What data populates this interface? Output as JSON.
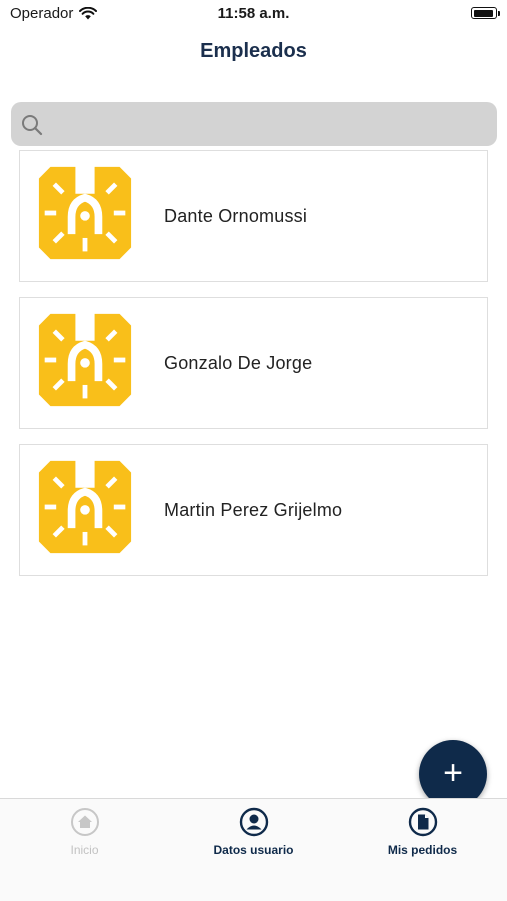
{
  "status_bar": {
    "carrier": "Operador",
    "time": "11:58 a.m."
  },
  "nav": {
    "title": "Empleados"
  },
  "search": {
    "placeholder": ""
  },
  "employees": [
    {
      "name": "Dante  Ornomussi"
    },
    {
      "name": "Gonzalo  De Jorge"
    },
    {
      "name": "Martin  Perez Grijelmo"
    }
  ],
  "fab": {
    "label": "+"
  },
  "tabs": [
    {
      "label": "Inicio",
      "icon": "home-icon"
    },
    {
      "label": "Datos usuario",
      "icon": "user-icon"
    },
    {
      "label": "Mis pedidos",
      "icon": "document-icon"
    }
  ],
  "colors": {
    "accent": "#0f2a4a",
    "logo": "#f9bf1a",
    "search_bg": "#d3d3d3"
  }
}
